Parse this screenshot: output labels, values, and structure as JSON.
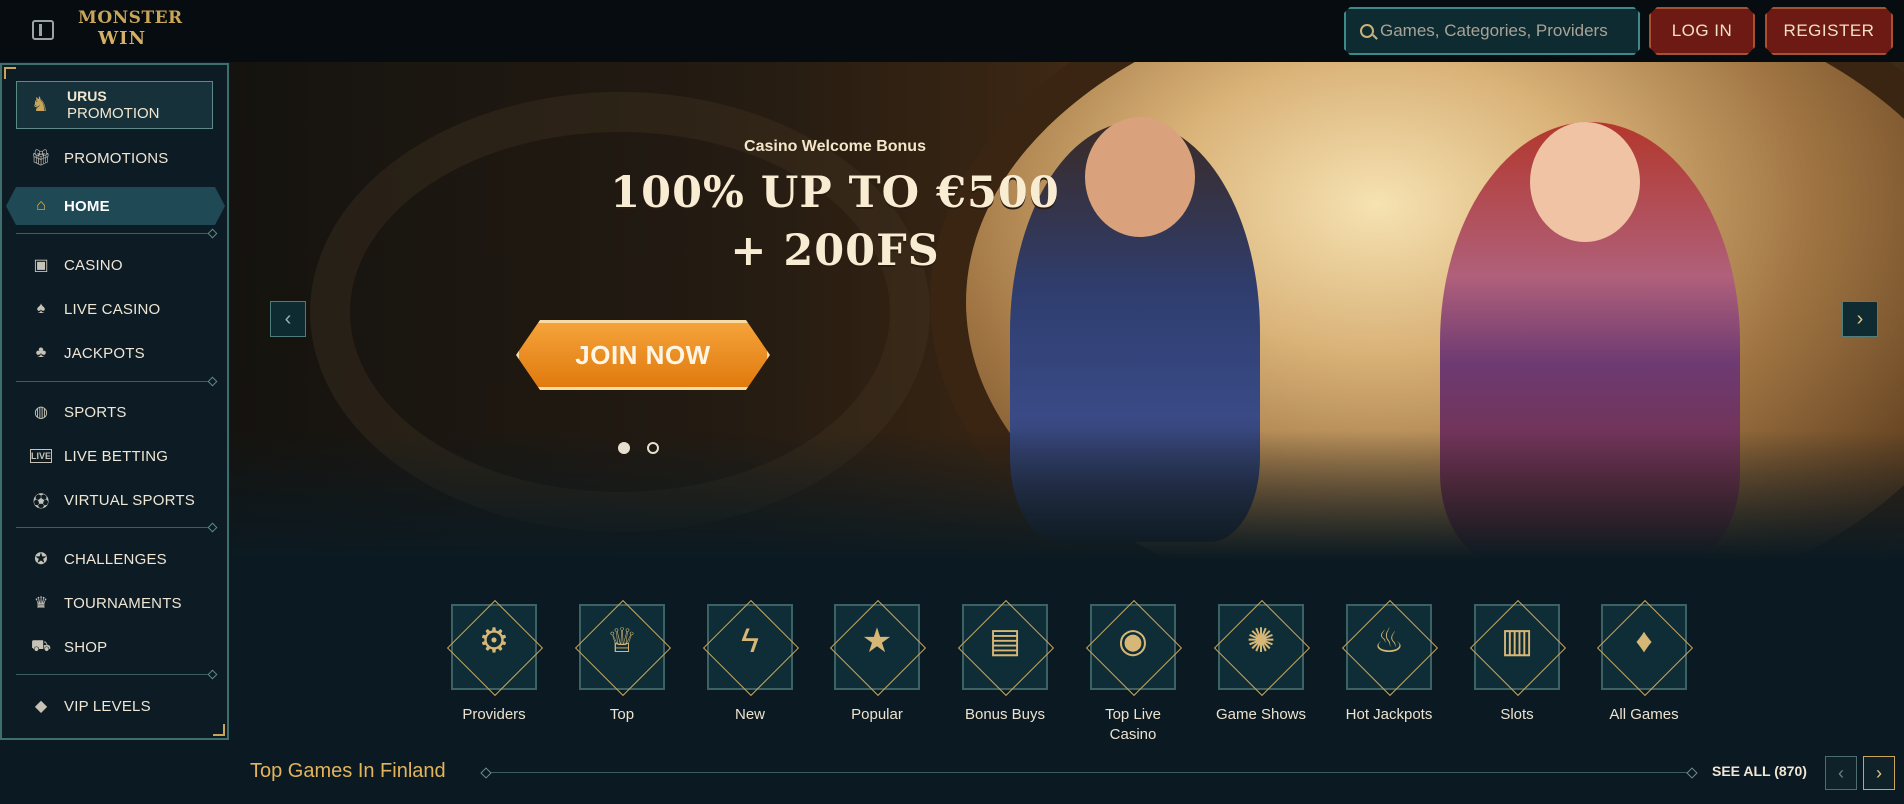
{
  "header": {
    "logo_line1": "MONSTER",
    "logo_line2": "WIN",
    "search_placeholder": "Games, Categories, Providers",
    "login_label": "LOG IN",
    "register_label": "REGISTER"
  },
  "sidebar": {
    "promo_card": {
      "title": "URUS",
      "subtitle": "PROMOTION"
    },
    "items": [
      {
        "label": "PROMOTIONS",
        "icon": "gift-icon"
      },
      {
        "label": "HOME",
        "icon": "home-icon"
      },
      {
        "label": "CASINO",
        "icon": "slot-machine-icon"
      },
      {
        "label": "LIVE CASINO",
        "icon": "cards-icon"
      },
      {
        "label": "JACKPOTS",
        "icon": "clover-icon"
      },
      {
        "label": "SPORTS",
        "icon": "basketball-icon"
      },
      {
        "label": "LIVE BETTING",
        "icon": "live-icon"
      },
      {
        "label": "VIRTUAL SPORTS",
        "icon": "soccer-ball-icon"
      },
      {
        "label": "CHALLENGES",
        "icon": "medal-icon"
      },
      {
        "label": "TOURNAMENTS",
        "icon": "trophy-icon"
      },
      {
        "label": "SHOP",
        "icon": "shopping-bag-icon"
      },
      {
        "label": "VIP LEVELS",
        "icon": "diamond-icon"
      }
    ],
    "active_item": "HOME"
  },
  "hero": {
    "subtitle": "Casino Welcome Bonus",
    "headline_line1": "100% UP TO €500",
    "headline_line2": "+ 200FS",
    "cta_label": "JOIN NOW",
    "slide_count": 2,
    "active_slide": 1
  },
  "categories": [
    {
      "name": "Providers",
      "icon": "book-gear-icon"
    },
    {
      "name": "Top",
      "icon": "crown-icon"
    },
    {
      "name": "New",
      "icon": "lightning-icon"
    },
    {
      "name": "Popular",
      "icon": "star-icon"
    },
    {
      "name": "Bonus Buys",
      "icon": "treasure-chest-icon"
    },
    {
      "name": "Top Live\nCasino",
      "icon": "poker-chip-icon"
    },
    {
      "name": "Game Shows",
      "icon": "wheel-icon"
    },
    {
      "name": "Hot Jackpots",
      "icon": "flame-icon"
    },
    {
      "name": "Slots",
      "icon": "slot-machine-icon"
    },
    {
      "name": "All Games",
      "icon": "diamond-cherries-icon"
    }
  ],
  "section": {
    "title": "Top Games In Finland",
    "see_all_label": "SEE ALL (870)"
  },
  "colors": {
    "background": "#0b1a22",
    "accent_gold": "#c9a55a",
    "cta_orange": "#e07a0e",
    "button_red": "#6d1a14",
    "teal_border": "#3d8a8c"
  }
}
